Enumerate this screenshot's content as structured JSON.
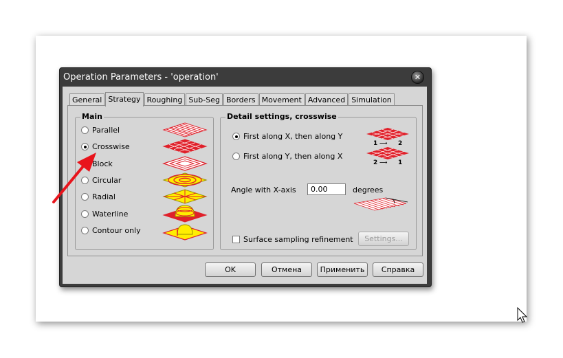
{
  "window": {
    "title": "Operation Parameters - 'operation'"
  },
  "tabs": [
    {
      "label": "General"
    },
    {
      "label": "Strategy",
      "active": true
    },
    {
      "label": "Roughing"
    },
    {
      "label": "Sub-Seg"
    },
    {
      "label": "Borders"
    },
    {
      "label": "Movement"
    },
    {
      "label": "Advanced"
    },
    {
      "label": "Simulation"
    }
  ],
  "main": {
    "title": "Main",
    "options": [
      {
        "label": "Parallel",
        "checked": false
      },
      {
        "label": "Crosswise",
        "checked": true
      },
      {
        "label": "Block",
        "checked": false
      },
      {
        "label": "Circular",
        "checked": false
      },
      {
        "label": "Radial",
        "checked": false
      },
      {
        "label": "Waterline",
        "checked": false
      },
      {
        "label": "Contour only",
        "checked": false
      }
    ]
  },
  "detail": {
    "title": "Detail settings, crosswise",
    "options": [
      {
        "label": "First along X, then along Y",
        "checked": true
      },
      {
        "label": "First along Y, then along X",
        "checked": false
      }
    ],
    "thumb1_labels": [
      "1",
      "2"
    ],
    "thumb2_labels": [
      "2",
      "1"
    ],
    "angle_label": "Angle with X-axis",
    "angle_value": "0.00",
    "angle_unit": "degrees",
    "surface_sampling_label": "Surface sampling refinement",
    "surface_sampling_checked": false,
    "settings_button": "Settings..."
  },
  "buttons": {
    "ok": "OK",
    "cancel": "Отмена",
    "apply": "Применить",
    "help": "Справка"
  },
  "colors": {
    "pattern_red": "#e0202a",
    "pattern_yellow": "#ffee00",
    "arrow_red": "#e8141c",
    "dialog_frame": "#3c3c3c",
    "dialog_face": "#d6d6d6"
  }
}
